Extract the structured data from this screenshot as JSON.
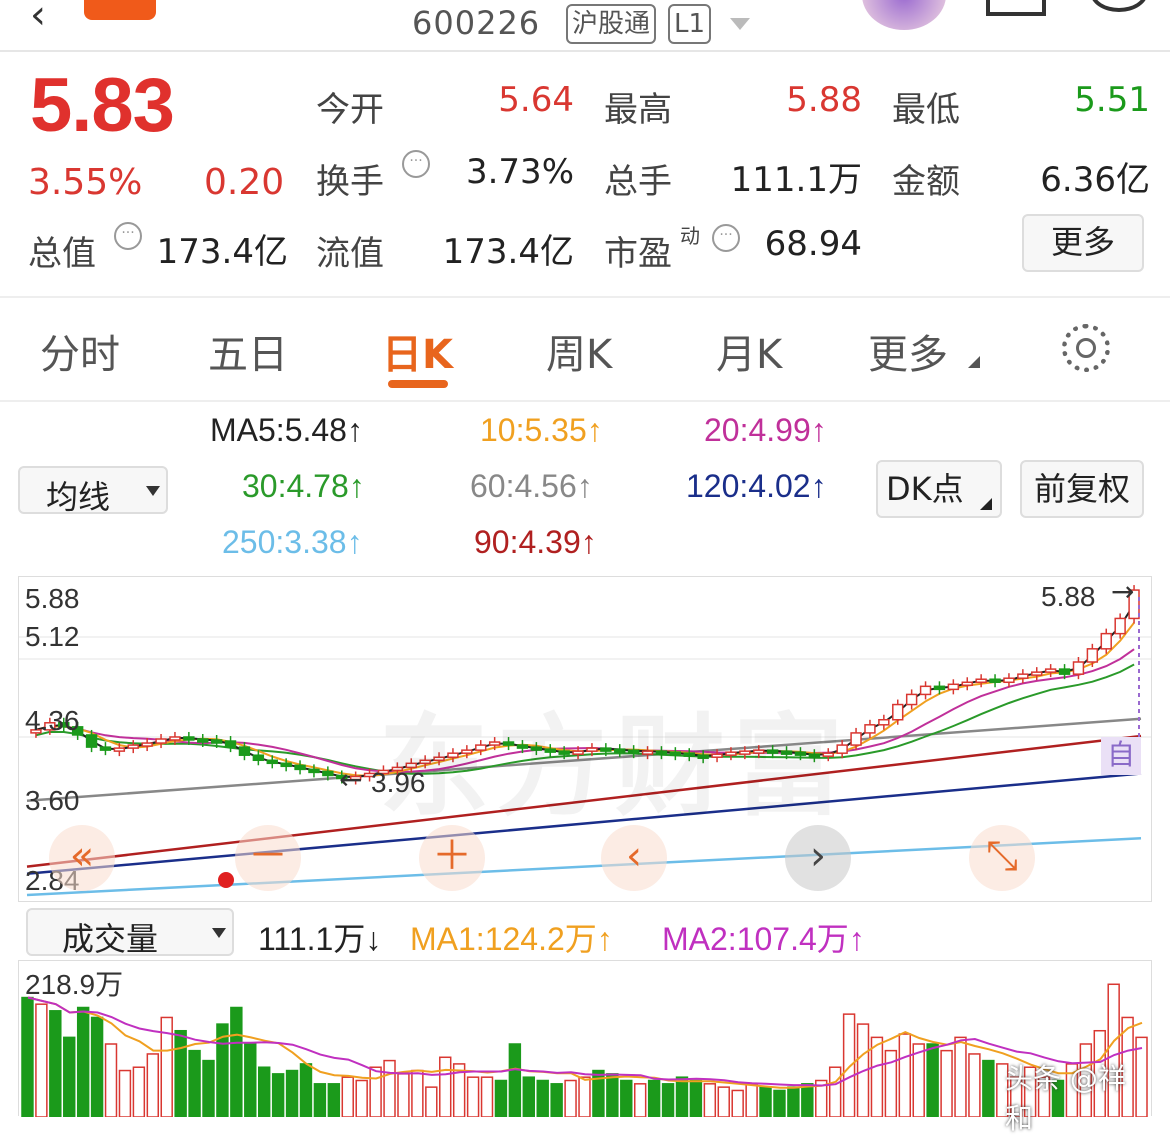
{
  "header": {
    "code": "600226",
    "tags": [
      "沪股通",
      "L1"
    ]
  },
  "quote": {
    "price": "5.83",
    "change_pct": "3.55%",
    "change": "0.20",
    "fields": [
      {
        "label": "今开",
        "value": "5.64",
        "color": "red"
      },
      {
        "label": "最高",
        "value": "5.88",
        "color": "red"
      },
      {
        "label": "最低",
        "value": "5.51",
        "color": "green"
      },
      {
        "label": "换手",
        "value": "3.73%",
        "color": "dark"
      },
      {
        "label": "总手",
        "value": "111.1万",
        "color": "dark"
      },
      {
        "label": "金额",
        "value": "6.36亿",
        "color": "dark"
      },
      {
        "label": "总值",
        "value": "173.4亿",
        "color": "dark"
      },
      {
        "label": "流值",
        "value": "173.4亿",
        "color": "dark"
      },
      {
        "label": "市盈",
        "value": "68.94",
        "color": "dark",
        "sup": "动"
      }
    ],
    "more": "更多"
  },
  "tabs": [
    "分时",
    "五日",
    "日K",
    "周K",
    "月K",
    "更多"
  ],
  "active_tab": "日K",
  "ma": {
    "selector": "均线",
    "dk": "DK点",
    "fq": "前复权",
    "items": [
      {
        "text": "MA5:5.48↑",
        "color": "#222222"
      },
      {
        "text": "10:5.35↑",
        "color": "#f0a020"
      },
      {
        "text": "20:4.99↑",
        "color": "#c0309a"
      },
      {
        "text": "30:4.78↑",
        "color": "#2a9a2a"
      },
      {
        "text": "60:4.56↑",
        "color": "#888888"
      },
      {
        "text": "120:4.02↑",
        "color": "#1a2e8a"
      },
      {
        "text": "250:3.38↑",
        "color": "#6cbde8"
      },
      {
        "text": "90:4.39↑",
        "color": "#b02020"
      }
    ]
  },
  "kchart": {
    "yticks": [
      "5.88",
      "5.12",
      "4.36",
      "3.60",
      "2.84"
    ],
    "high_label": "5.88",
    "low_label": "3.96",
    "auto": "自",
    "watermark": "东方财富",
    "ylim": [
      2.84,
      5.88
    ],
    "closes": [
      4.45,
      4.52,
      4.48,
      4.4,
      4.28,
      4.25,
      4.27,
      4.3,
      4.32,
      4.36,
      4.38,
      4.36,
      4.35,
      4.34,
      4.28,
      4.2,
      4.15,
      4.12,
      4.1,
      4.06,
      4.04,
      4.0,
      3.98,
      3.99,
      4.02,
      4.05,
      4.08,
      4.12,
      4.15,
      4.18,
      4.22,
      4.25,
      4.3,
      4.33,
      4.3,
      4.28,
      4.26,
      4.24,
      4.22,
      4.24,
      4.27,
      4.26,
      4.25,
      4.24,
      4.24,
      4.23,
      4.22,
      4.2,
      4.19,
      4.21,
      4.23,
      4.24,
      4.25,
      4.24,
      4.23,
      4.21,
      4.2,
      4.22,
      4.3,
      4.42,
      4.5,
      4.55,
      4.7,
      4.8,
      4.88,
      4.85,
      4.9,
      4.92,
      4.95,
      4.92,
      4.96,
      5.0,
      5.02,
      5.05,
      5.0,
      5.12,
      5.25,
      5.4,
      5.55,
      5.83
    ]
  },
  "volume": {
    "selector": "成交量",
    "value": "111.1万↓",
    "ma1": "MA1:124.2万↑",
    "ma2": "MA2:107.4万↑",
    "ymax_label": "218.9万",
    "values": [
      180,
      170,
      160,
      120,
      165,
      150,
      110,
      70,
      75,
      95,
      150,
      130,
      100,
      85,
      140,
      165,
      110,
      75,
      65,
      70,
      80,
      50,
      50,
      60,
      55,
      75,
      85,
      65,
      70,
      45,
      90,
      80,
      60,
      60,
      55,
      110,
      60,
      55,
      50,
      55,
      60,
      70,
      65,
      55,
      50,
      55,
      50,
      60,
      55,
      50,
      45,
      40,
      50,
      45,
      40,
      45,
      50,
      55,
      75,
      155,
      140,
      120,
      100,
      125,
      110,
      110,
      100,
      120,
      95,
      85,
      80,
      60,
      75,
      60,
      55,
      80,
      110,
      130,
      200,
      150,
      120
    ]
  },
  "watermark_author": "头条 @祥和"
}
